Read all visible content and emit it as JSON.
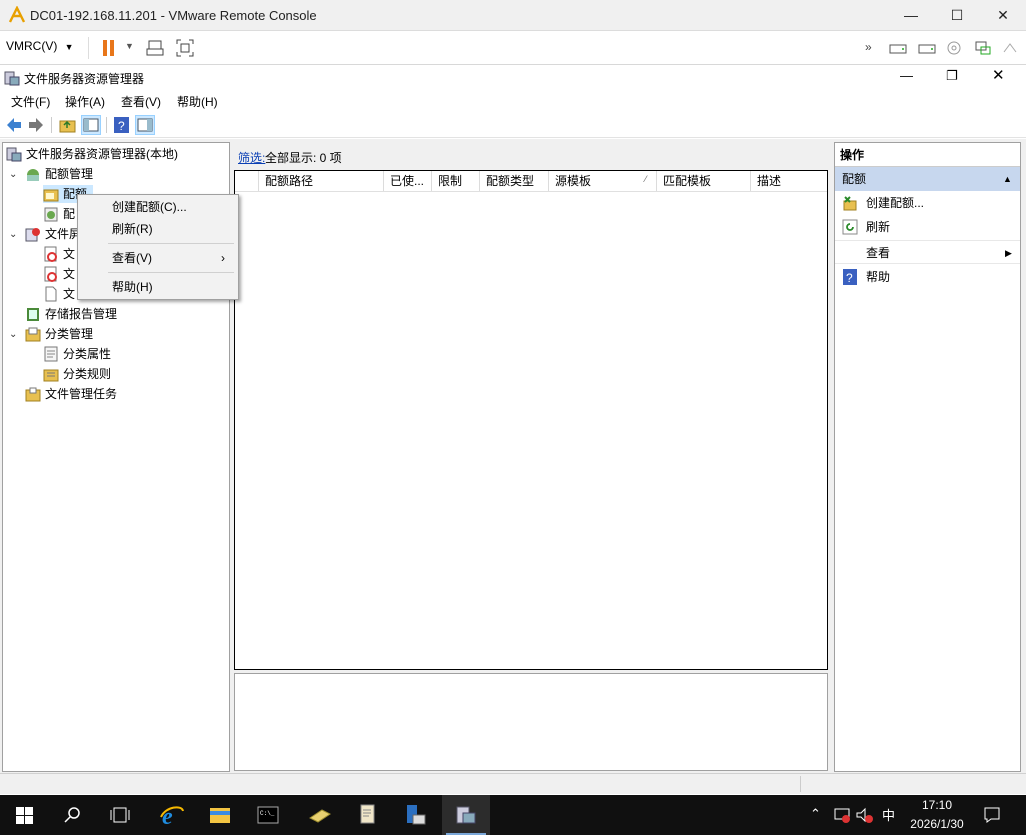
{
  "vmrc": {
    "title": "DC01-192.168.11.201 - VMware Remote Console",
    "menu_label": "VMRC(V)",
    "window_controls": [
      "minimize-icon",
      "maximize-icon",
      "close-icon"
    ]
  },
  "mmc": {
    "title": "文件服务器资源管理器",
    "menu": [
      "文件(F)",
      "操作(A)",
      "查看(V)",
      "帮助(H)"
    ]
  },
  "tree": {
    "root": "文件服务器资源管理器(本地)",
    "quota_mgmt": "配额管理",
    "quota": "配额",
    "quota_templates": "配",
    "file_screen_mgmt": "文件屏",
    "fs1": "文",
    "fs2": "文",
    "fs3": "文",
    "storage_reports": "存储报告管理",
    "classification": "分类管理",
    "class_props": "分类属性",
    "class_rules": "分类规则",
    "file_tasks": "文件管理任务"
  },
  "center": {
    "filter_link": "筛选:",
    "filter_text": "全部显示:  0 项",
    "columns": [
      "配额路径",
      "已使...",
      "限制",
      "配额类型",
      "源模板",
      "匹配模板",
      "描述"
    ]
  },
  "actions": {
    "header": "操作",
    "section": "配额",
    "items": [
      {
        "label": "创建配额...",
        "icon": "create-quota-icon"
      },
      {
        "label": "刷新",
        "icon": "refresh-icon"
      },
      {
        "label": "查看",
        "icon": ""
      },
      {
        "label": "帮助",
        "icon": "help-icon"
      }
    ]
  },
  "context_menu": {
    "items": [
      "创建配额(C)...",
      "刷新(R)",
      "查看(V)",
      "帮助(H)"
    ]
  },
  "taskbar": {
    "ime": "中",
    "time": "17:10",
    "date": "2026/1/30"
  },
  "colors": {
    "accent": "#0a5fb4",
    "selection": "#cce8ff",
    "actions_section": "#c7d7ee"
  }
}
